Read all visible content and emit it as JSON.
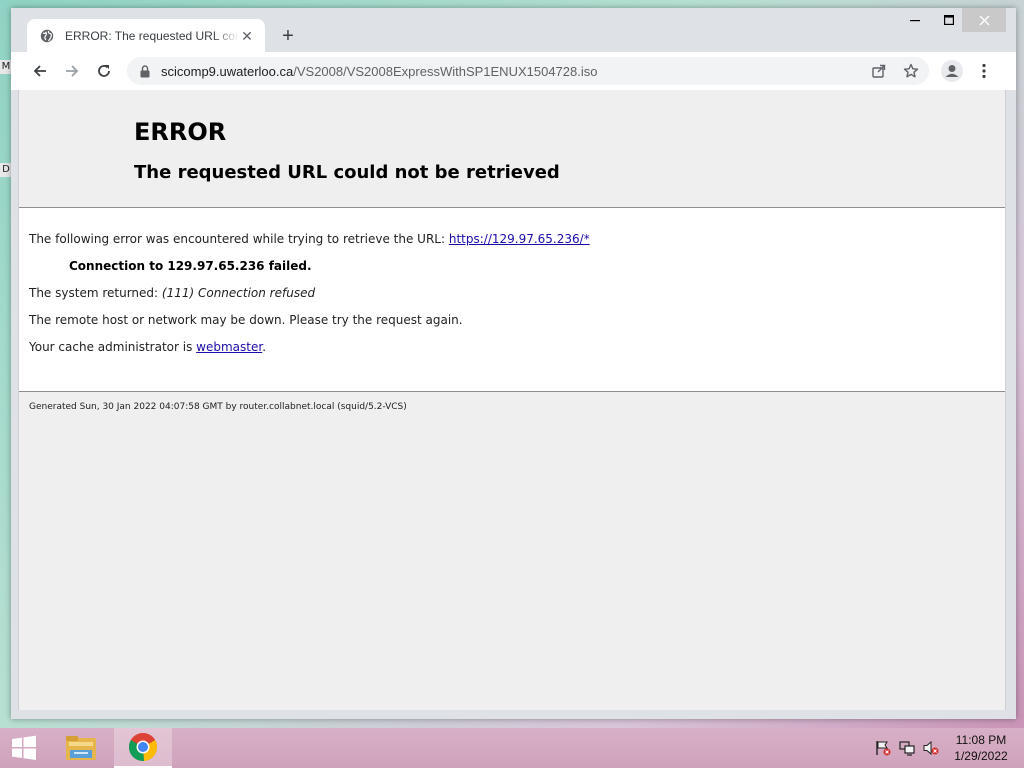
{
  "browser": {
    "tab": {
      "title": "ERROR: The requested URL could not be retrieved"
    },
    "new_tab_label": "+",
    "url": {
      "host": "scicomp9.uwaterloo.ca",
      "path": "/VS2008/VS2008ExpressWithSP1ENUX1504728.iso"
    }
  },
  "page": {
    "title": "ERROR",
    "subtitle": "The requested URL could not be retrieved",
    "line1_prefix": "The following error was encountered while trying to retrieve the URL: ",
    "line1_link": "https://129.97.65.236/*",
    "line2": "Connection to 129.97.65.236 failed.",
    "line3_prefix": "The system returned: ",
    "line3_detail": "(111) Connection refused",
    "line4": "The remote host or network may be down. Please try the request again.",
    "line5_prefix": "Your cache administrator is ",
    "line5_link": "webmaster",
    "line5_suffix": ".",
    "footer": "Generated Sun, 30 Jan 2022 04:07:58 GMT by router.collabnet.local (squid/5.2-VCS)"
  },
  "desktop": {
    "glyph_top": "M",
    "glyph_mid": "D"
  },
  "taskbar": {
    "time": "11:08 PM",
    "date": "1/29/2022"
  },
  "colors": {
    "link": "#1a0dab",
    "taskbar": "#d3a8bf",
    "chrome_frame": "#dee1e6"
  }
}
